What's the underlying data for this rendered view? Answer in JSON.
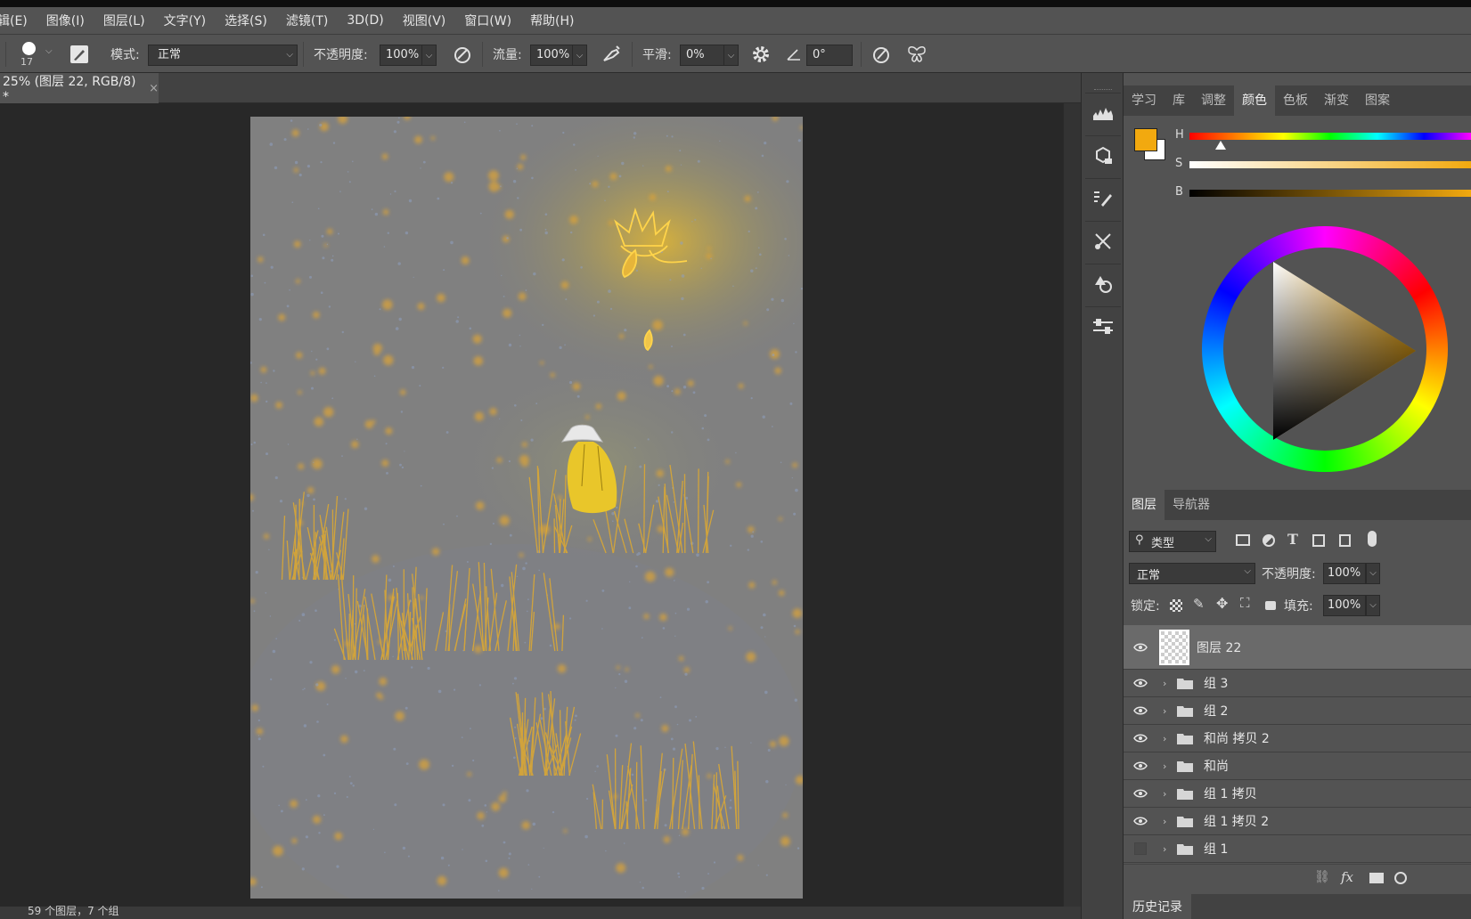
{
  "menu": [
    "辑(E)",
    "图像(I)",
    "图层(L)",
    "文字(Y)",
    "选择(S)",
    "滤镜(T)",
    "3D(D)",
    "视图(V)",
    "窗口(W)",
    "帮助(H)"
  ],
  "options": {
    "brush_size": "17",
    "mode_label": "模式:",
    "mode_value": "正常",
    "opacity_label": "不透明度:",
    "opacity_value": "100%",
    "flow_label": "流量:",
    "flow_value": "100%",
    "smoothing_label": "平滑:",
    "smoothing_value": "0%",
    "angle_value": "0°"
  },
  "document_tab": {
    "title": "25% (图层 22, RGB/8) *",
    "close": "×"
  },
  "status": "59 个图层，7 个组",
  "top_panel_tabs": [
    "学习",
    "库",
    "调整",
    "颜色",
    "色板",
    "渐变",
    "图案"
  ],
  "active_top_tab": "颜色",
  "color": {
    "h_label": "H",
    "s_label": "S",
    "b_label": "B",
    "foreground": "#f2a90f",
    "background": "#ffffff",
    "hue_fraction": 0.11
  },
  "layer_panel_tabs": [
    "图层",
    "导航器"
  ],
  "layers_controls": {
    "filter": "类型",
    "blend": "正常",
    "opacity_label": "不透明度:",
    "opacity_value": "100%",
    "lock_label": "锁定:",
    "fill_label": "填充:",
    "fill_value": "100%"
  },
  "layers": [
    {
      "name": "图层 22",
      "type": "layer",
      "visible": true,
      "selected": true
    },
    {
      "name": "组 3",
      "type": "group",
      "visible": true
    },
    {
      "name": "组 2",
      "type": "group",
      "visible": true
    },
    {
      "name": "和尚 拷贝 2",
      "type": "group",
      "visible": true
    },
    {
      "name": "和尚",
      "type": "group",
      "visible": true
    },
    {
      "name": "组 1 拷贝",
      "type": "group",
      "visible": true
    },
    {
      "name": "组 1 拷贝 2",
      "type": "group",
      "visible": true
    },
    {
      "name": "组 1",
      "type": "group",
      "visible": false
    }
  ],
  "history_tab": "历史记录",
  "icons": {
    "brush_preset": "brush-dot-icon",
    "toggle_brush_panel": "brush-panel-icon",
    "pressure_opacity": "pressure-opacity-icon",
    "airbrush": "airbrush-icon",
    "settings": "gear-icon",
    "angle": "angle-icon",
    "pressure_size": "pressure-size-icon",
    "symmetry": "butterfly-icon"
  }
}
